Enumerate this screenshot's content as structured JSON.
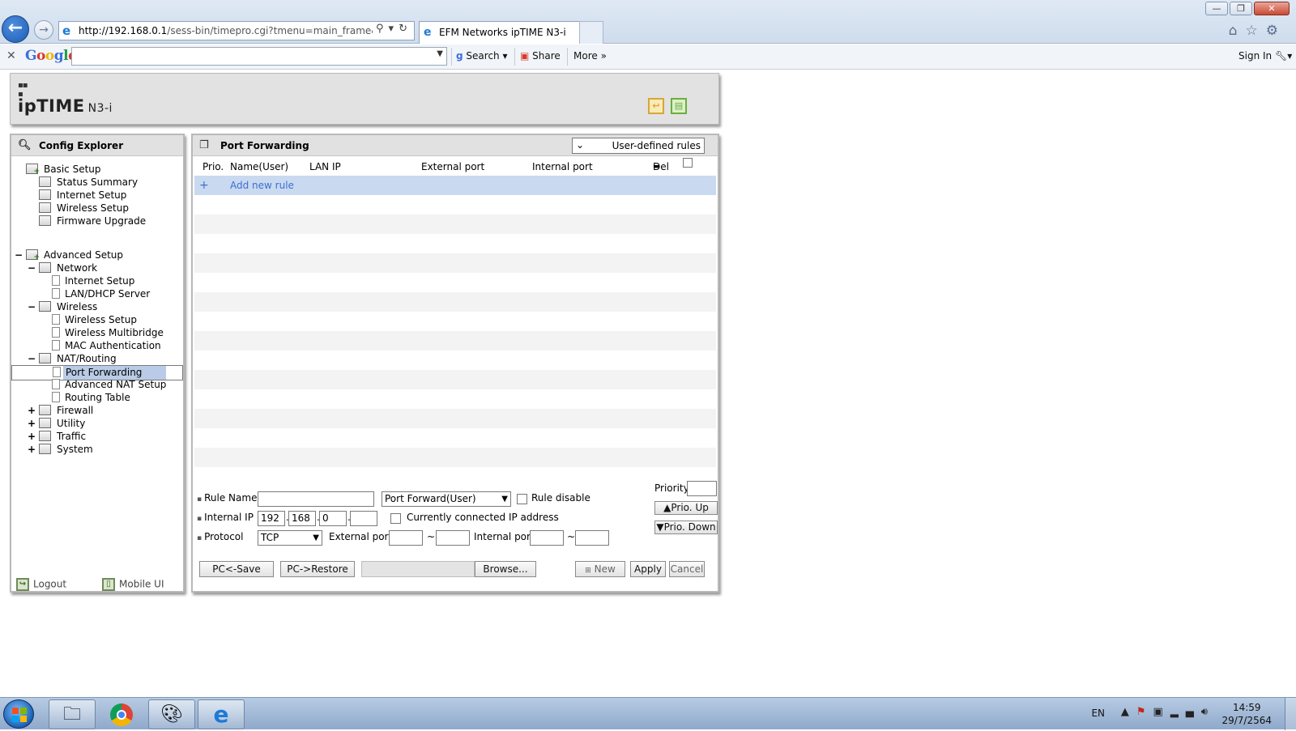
{
  "browser": {
    "url_host": "http://192.168.0.1",
    "url_path": "/sess-bin/timepro.cgi?tmenu=main_frame&smenu",
    "tab_title": "EFM Networks ipTIME N3-i",
    "window_buttons": [
      "—",
      "❐",
      "✕"
    ]
  },
  "toolbar": {
    "google": [
      "G",
      "o",
      "o",
      "g",
      "l",
      "e"
    ],
    "search_label": "Search",
    "share_label": "Share",
    "more_label": "More »",
    "signin_label": "Sign In"
  },
  "header": {
    "logo_text": "ipTIME",
    "model": "N3-i"
  },
  "sidebar": {
    "title": "Config Explorer",
    "tree": [
      {
        "label": "Basic Setup",
        "exp": "",
        "level": 0,
        "type": "folder",
        "badge": "+"
      },
      {
        "label": "Status Summary",
        "exp": "",
        "level": 1,
        "type": "folder",
        "badge": ""
      },
      {
        "label": "Internet Setup",
        "exp": "",
        "level": 1,
        "type": "folder",
        "badge": ""
      },
      {
        "label": "Wireless Setup",
        "exp": "",
        "level": 1,
        "type": "folder",
        "badge": ""
      },
      {
        "label": "Firmware Upgrade",
        "exp": "",
        "level": 1,
        "type": "folder",
        "badge": ""
      },
      {
        "label": "Advanced Setup",
        "exp": "−",
        "level": 0,
        "type": "folder",
        "badge": "+"
      },
      {
        "label": "Network",
        "exp": "−",
        "level": 1,
        "type": "folder",
        "badge": ""
      },
      {
        "label": "Internet Setup",
        "exp": "",
        "level": 2,
        "type": "doc",
        "badge": ""
      },
      {
        "label": "LAN/DHCP Server",
        "exp": "",
        "level": 2,
        "type": "doc",
        "badge": ""
      },
      {
        "label": "Wireless",
        "exp": "−",
        "level": 1,
        "type": "folder",
        "badge": ""
      },
      {
        "label": "Wireless Setup",
        "exp": "",
        "level": 2,
        "type": "doc",
        "badge": ""
      },
      {
        "label": "Wireless Multibridge",
        "exp": "",
        "level": 2,
        "type": "doc",
        "badge": ""
      },
      {
        "label": "MAC Authentication",
        "exp": "",
        "level": 2,
        "type": "doc",
        "badge": ""
      },
      {
        "label": "NAT/Routing",
        "exp": "−",
        "level": 1,
        "type": "folder",
        "badge": ""
      },
      {
        "label": "Port Forwarding",
        "exp": "",
        "level": 2,
        "type": "doc",
        "badge": "",
        "selected": true
      },
      {
        "label": "Advanced NAT Setup",
        "exp": "",
        "level": 2,
        "type": "doc",
        "badge": ""
      },
      {
        "label": "Routing Table",
        "exp": "",
        "level": 2,
        "type": "doc",
        "badge": ""
      },
      {
        "label": "Firewall",
        "exp": "+",
        "level": 1,
        "type": "folder",
        "badge": ""
      },
      {
        "label": "Utility",
        "exp": "+",
        "level": 1,
        "type": "folder",
        "badge": ""
      },
      {
        "label": "Traffic",
        "exp": "+",
        "level": 1,
        "type": "folder",
        "badge": ""
      },
      {
        "label": "System",
        "exp": "+",
        "level": 1,
        "type": "folder",
        "badge": ""
      }
    ],
    "logout_label": "Logout",
    "mobile_label": "Mobile UI"
  },
  "main": {
    "title": "Port Forwarding",
    "rules_select": "User-defined rules",
    "columns": {
      "prio": "Prio.",
      "name": "Name(User)",
      "lan_ip": "LAN IP",
      "external_port": "External port",
      "internal_port": "Internal port",
      "del": "Del"
    },
    "add_rule_label": "Add new rule",
    "empty_rows": 15,
    "form": {
      "rule_name_label": "Rule Name",
      "rule_name_value": "",
      "rule_type_value": "Port Forward(User)",
      "rule_disable_label": "Rule disable",
      "priority_label": "Priority",
      "priority_value": "",
      "internal_ip_label": "Internal IP",
      "ip1": "192",
      "ip2": "168",
      "ip3": "0",
      "ip4": "",
      "connected_ip_label": "Currently connected IP address",
      "protocol_label": "Protocol",
      "protocol_value": "TCP",
      "external_port_label": "External port",
      "internal_port_label": "Internal port",
      "tilde": "~",
      "prio_up_label": "▲Prio. Up",
      "prio_down_label": "▼Prio. Down"
    },
    "buttons": {
      "pc_save": "PC<-Save",
      "pc_restore": "PC->Restore",
      "browse": "Browse...",
      "new": "New",
      "apply": "Apply",
      "cancel": "Cancel"
    }
  },
  "taskbar": {
    "lang": "EN",
    "time": "14:59",
    "date": "29/7/2564"
  },
  "colors": {
    "selection": "#b9cbe6",
    "add_row": "#c9d9f0",
    "link_blue": "#3d6fd1",
    "panel_header": "#e1e1e1"
  }
}
